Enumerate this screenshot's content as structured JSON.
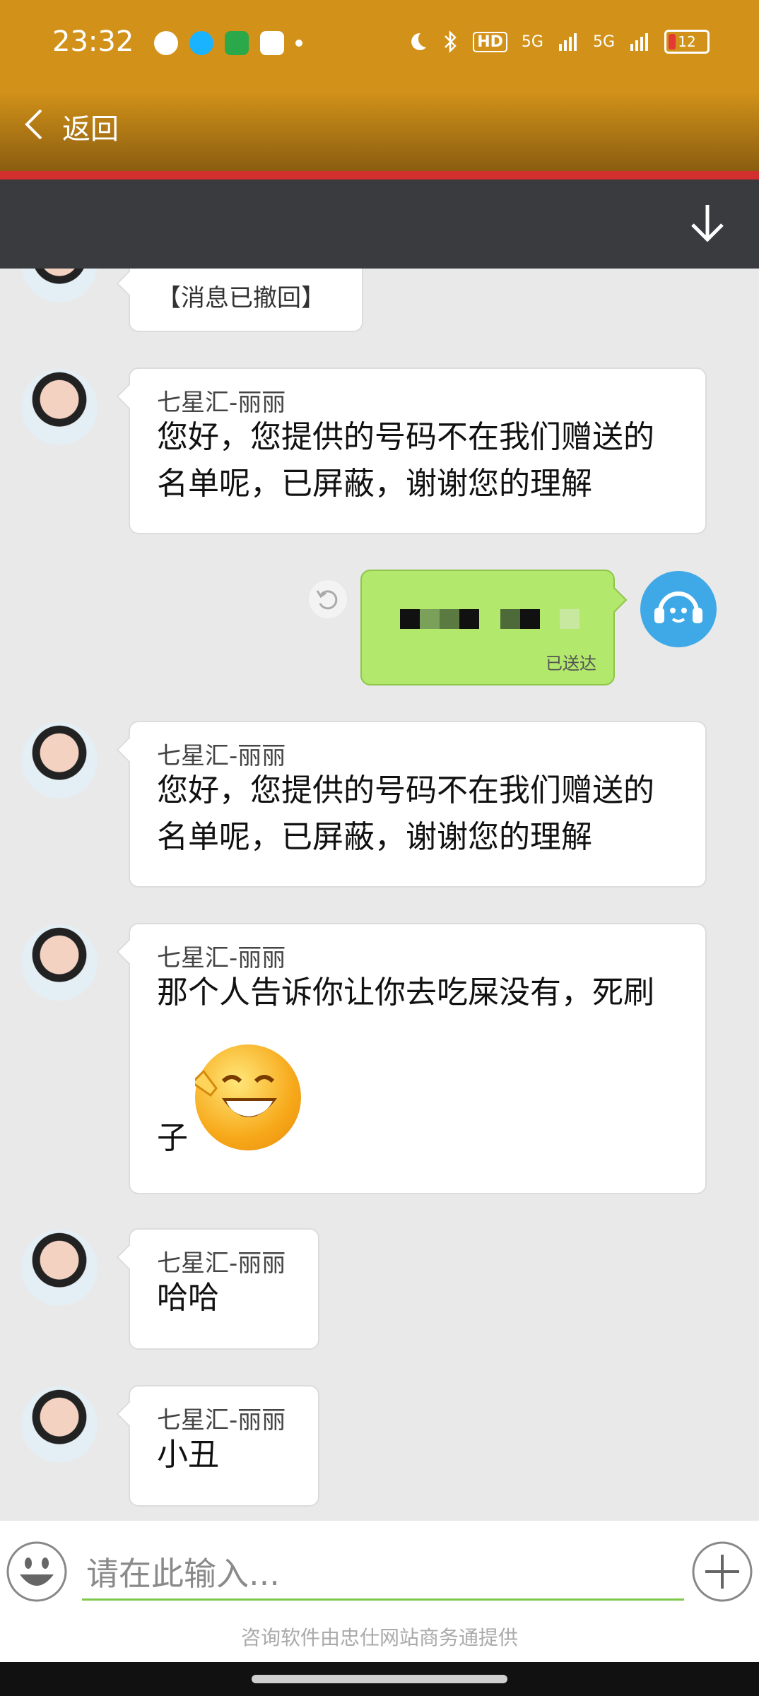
{
  "status_bar": {
    "time": "23:32",
    "hd": "HD",
    "network1": "5G",
    "network2": "5G",
    "battery": "12"
  },
  "header": {
    "back_label": "返回"
  },
  "messages": {
    "recalled": "【消息已撤回】",
    "m1": {
      "sender": "七星汇-丽丽",
      "line1": "您好，您提供的号码不在我们赠送的",
      "line2": "名单呢，已屏蔽，谢谢您的理解"
    },
    "sent": {
      "status": "已送达"
    },
    "m2": {
      "sender": "七星汇-丽丽",
      "line1": "您好，您提供的号码不在我们赠送的",
      "line2": "名单呢，已屏蔽，谢谢您的理解"
    },
    "m3": {
      "sender": "七星汇-丽丽",
      "line1": "那个人告诉你让你去吃屎没有，死刷",
      "line2": "子"
    },
    "m4": {
      "sender": "七星汇-丽丽",
      "text": "哈哈"
    },
    "m5": {
      "sender": "七星汇-丽丽",
      "text": "小丑"
    }
  },
  "input": {
    "placeholder": "请在此输入..."
  },
  "footer": {
    "note": "咨询软件由忠仕网站商务通提供"
  },
  "colors": {
    "header": "#d29219",
    "sent_bubble": "#b2e86b",
    "toolbar": "#3a3b3f",
    "accent_red": "#d32f2f"
  }
}
